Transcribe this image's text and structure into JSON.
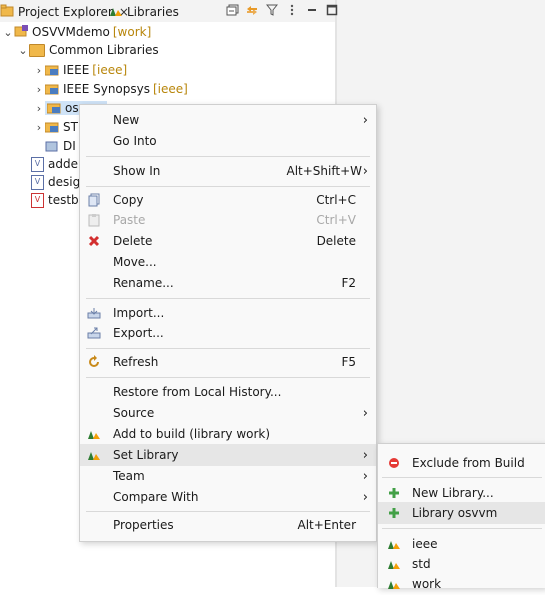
{
  "tabs": {
    "project_explorer": "Project Explorer",
    "libraries": "Libraries",
    "close_glyph": "×"
  },
  "tree": {
    "project": {
      "name": "OSVVMdemo",
      "decor": "[work]"
    },
    "common_libraries": "Common Libraries",
    "libs": [
      {
        "name": "IEEE",
        "decor": "[ieee]"
      },
      {
        "name": "IEEE Synopsys",
        "decor": "[ieee]"
      },
      {
        "name": "osvvm",
        "decor": ""
      },
      {
        "name": "ST",
        "decor": ""
      },
      {
        "name": "DI",
        "decor": ""
      }
    ],
    "files": [
      {
        "name": "adde",
        "icon": "vhdl-file-icon"
      },
      {
        "name": "desig",
        "icon": "vhdl-file-icon"
      },
      {
        "name": "testb",
        "icon": "vhdl-testbench-icon"
      }
    ]
  },
  "menu": {
    "new": "New",
    "go_into": "Go Into",
    "show_in": "Show In",
    "show_in_acc": "Alt+Shift+W",
    "copy": "Copy",
    "copy_acc": "Ctrl+C",
    "paste": "Paste",
    "paste_acc": "Ctrl+V",
    "delete": "Delete",
    "delete_acc": "Delete",
    "move": "Move...",
    "rename": "Rename...",
    "rename_acc": "F2",
    "import": "Import...",
    "export": "Export...",
    "refresh": "Refresh",
    "refresh_acc": "F5",
    "restore": "Restore from Local History...",
    "source": "Source",
    "add_to_build": "Add to build (library work)",
    "set_library": "Set Library",
    "team": "Team",
    "compare_with": "Compare With",
    "properties": "Properties",
    "properties_acc": "Alt+Enter",
    "arrow": "›"
  },
  "submenu": {
    "exclude": "Exclude from Build",
    "new_library": "New Library...",
    "library_osvvm": "Library osvvm",
    "ieee": "ieee",
    "std": "std",
    "work": "work"
  },
  "colors": {
    "selection": "#cfe3f7",
    "menu_bg": "#f9f9f9",
    "hover": "#e6e6e6",
    "library_decor": "#b8860b"
  }
}
